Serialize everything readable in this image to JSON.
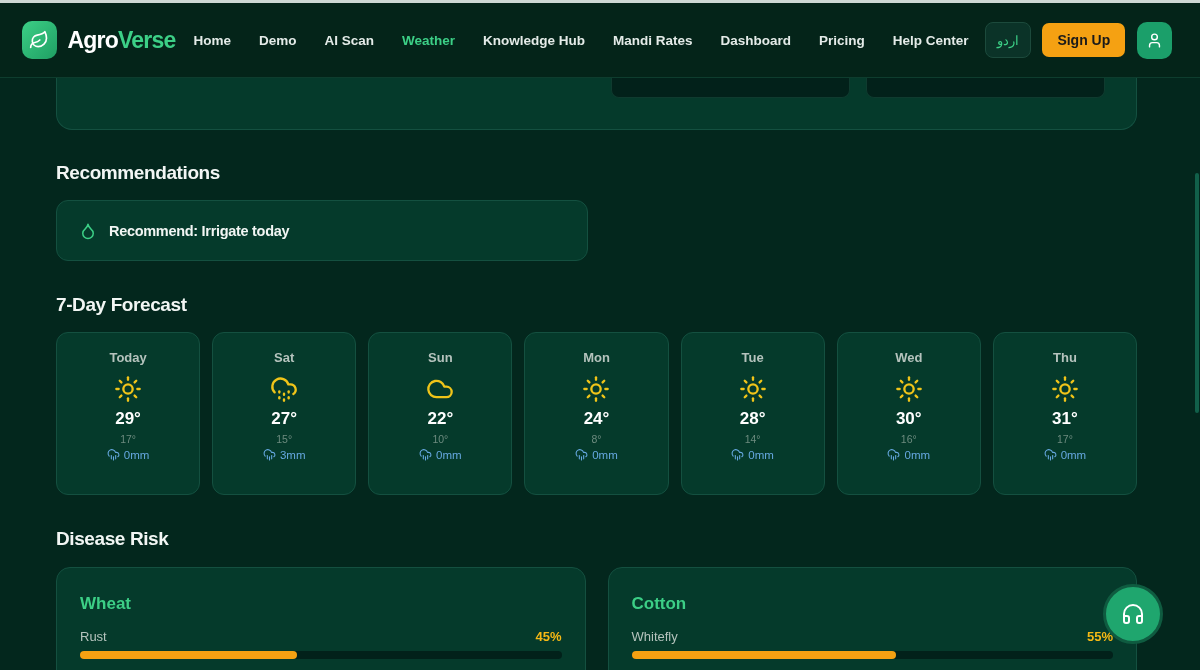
{
  "brand": {
    "first": "Agro",
    "second": "Verse"
  },
  "nav": [
    {
      "label": "Home",
      "selected": false
    },
    {
      "label": "Demo",
      "selected": false
    },
    {
      "label": "AI Scan",
      "selected": false
    },
    {
      "label": "Weather",
      "selected": true
    },
    {
      "label": "Knowledge Hub",
      "selected": false
    },
    {
      "label": "Mandi Rates",
      "selected": false
    },
    {
      "label": "Dashboard",
      "selected": false
    },
    {
      "label": "Pricing",
      "selected": false
    },
    {
      "label": "Help Center",
      "selected": false
    }
  ],
  "language_button": "اردو",
  "signup_button": "Sign Up",
  "recommendations": {
    "title": "Recommendations",
    "items": [
      "Recommend: Irrigate today"
    ]
  },
  "forecast": {
    "title": "7-Day Forecast",
    "days": [
      {
        "day": "Today",
        "kind": "sun",
        "high": "29°",
        "low": "17°",
        "rain": "0mm"
      },
      {
        "day": "Sat",
        "kind": "rain",
        "high": "27°",
        "low": "15°",
        "rain": "3mm"
      },
      {
        "day": "Sun",
        "kind": "cloud",
        "high": "22°",
        "low": "10°",
        "rain": "0mm"
      },
      {
        "day": "Mon",
        "kind": "sun",
        "high": "24°",
        "low": "8°",
        "rain": "0mm"
      },
      {
        "day": "Tue",
        "kind": "sun",
        "high": "28°",
        "low": "14°",
        "rain": "0mm"
      },
      {
        "day": "Wed",
        "kind": "sun",
        "high": "30°",
        "low": "16°",
        "rain": "0mm"
      },
      {
        "day": "Thu",
        "kind": "sun",
        "high": "31°",
        "low": "17°",
        "rain": "0mm"
      }
    ]
  },
  "disease_risk": {
    "title": "Disease Risk",
    "crops": [
      {
        "crop": "Wheat",
        "disease": "Rust",
        "reading": "45%",
        "level": 0.45
      },
      {
        "crop": "Cotton",
        "disease": "Whitefly",
        "reading": "55%",
        "level": 0.55
      }
    ]
  }
}
